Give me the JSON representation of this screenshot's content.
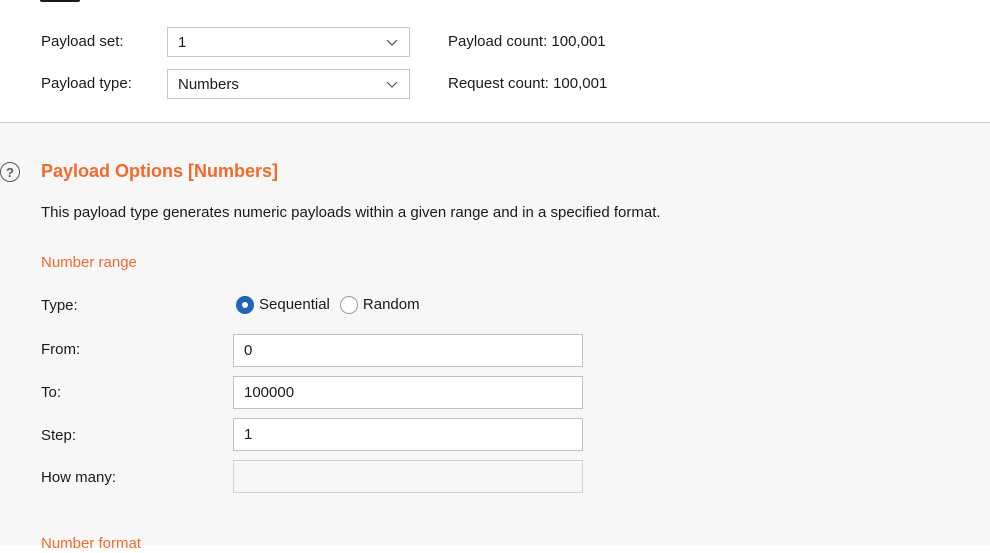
{
  "payload_sets": {
    "payload_set_label": "Payload set:",
    "payload_set_value": "1",
    "payload_type_label": "Payload type:",
    "payload_type_value": "Numbers",
    "payload_count": "Payload count: 100,001",
    "request_count": "Request count: 100,001"
  },
  "payload_options": {
    "title": "Payload Options [Numbers]",
    "description": "This payload type generates numeric payloads within a given range and in a specified format.",
    "number_range_heading": "Number range",
    "type_label": "Type:",
    "radio_sequential": "Sequential",
    "radio_random": "Random",
    "selected_type": "Sequential",
    "from_label": "From:",
    "from_value": "0",
    "to_label": "To:",
    "to_value": "100000",
    "step_label": "Step:",
    "step_value": "1",
    "how_many_label": "How many:",
    "how_many_value": "",
    "number_format_heading": "Number format"
  },
  "icons": {
    "help": "help-icon",
    "dropdown": "chevron-down-icon"
  },
  "colors": {
    "accent": "#f26a2b",
    "radio_selected": "#1e66b8",
    "panel_background": "#f7f7f7"
  }
}
